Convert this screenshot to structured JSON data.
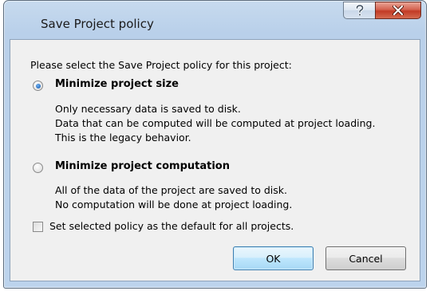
{
  "window": {
    "title": "Save Project policy",
    "help_glyph": "?",
    "close_glyph": "X"
  },
  "dialog": {
    "prompt": "Please select the Save Project policy for this project:",
    "options": [
      {
        "label": "Minimize project size",
        "selected": true,
        "description": [
          "Only necessary data is saved to disk.",
          "Data that can be computed will be computed at project loading.",
          "This is the legacy behavior."
        ]
      },
      {
        "label": "Minimize project computation",
        "selected": false,
        "description": [
          "All of the data of the project are saved to disk.",
          "No computation will be done at project loading."
        ]
      }
    ],
    "default_checkbox": {
      "label": "Set selected policy as the default for all projects.",
      "checked": false
    },
    "buttons": {
      "ok": "OK",
      "cancel": "Cancel"
    }
  },
  "colors": {
    "title_bar": "#b9d0ea",
    "client_bg": "#f0f0f0",
    "close_button": "#c23a25",
    "ok_border": "#3c7fb1"
  }
}
